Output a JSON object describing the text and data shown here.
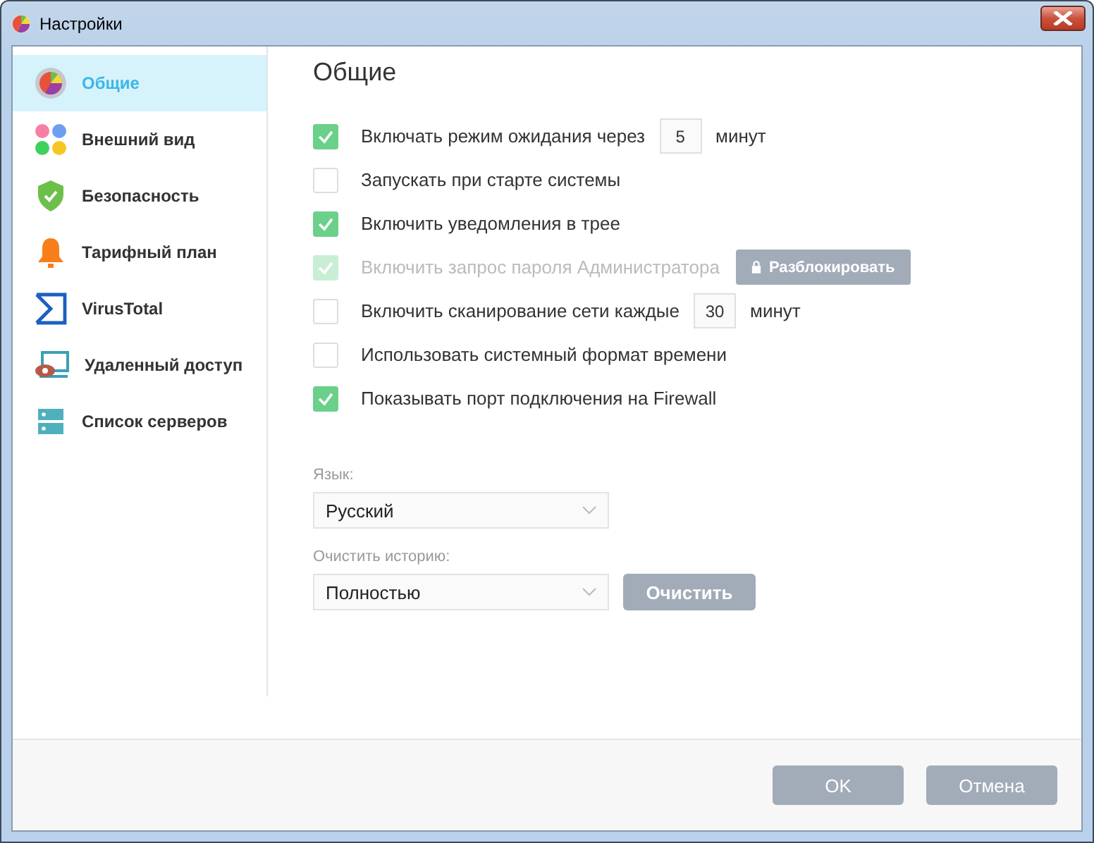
{
  "window": {
    "title": "Настройки"
  },
  "sidebar": {
    "items": [
      {
        "label": "Общие",
        "selected": true
      },
      {
        "label": "Внешний вид",
        "selected": false
      },
      {
        "label": "Безопасность",
        "selected": false
      },
      {
        "label": "Тарифный план",
        "selected": false
      },
      {
        "label": "VirusTotal",
        "selected": false
      },
      {
        "label": "Удаленный доступ",
        "selected": false
      },
      {
        "label": "Список серверов",
        "selected": false
      }
    ]
  },
  "heading": "Общие",
  "options": [
    {
      "kind": "minutes",
      "label": "Включать режим ожидания через",
      "checked": true,
      "disabled": false,
      "value": "5",
      "unit": "минут"
    },
    {
      "kind": "plain",
      "label": "Запускать при старте системы",
      "checked": false,
      "disabled": false
    },
    {
      "kind": "plain",
      "label": "Включить уведомления в трее",
      "checked": true,
      "disabled": false
    },
    {
      "kind": "unlock",
      "label": "Включить запрос пароля Администратора",
      "checked": true,
      "disabled": true,
      "button": "Разблокировать"
    },
    {
      "kind": "minutes",
      "label": "Включить сканирование сети каждые",
      "checked": false,
      "disabled": false,
      "value": "30",
      "unit": "минут"
    },
    {
      "kind": "plain",
      "label": "Использовать системный формат времени",
      "checked": false,
      "disabled": false
    },
    {
      "kind": "plain",
      "label": "Показывать порт подключения на Firewall",
      "checked": true,
      "disabled": false
    }
  ],
  "language": {
    "label": "Язык:",
    "value": "Русский"
  },
  "history": {
    "label": "Очистить историю:",
    "value": "Полностью",
    "button": "Очистить"
  },
  "buttons": [
    "OK",
    "Отмена"
  ]
}
